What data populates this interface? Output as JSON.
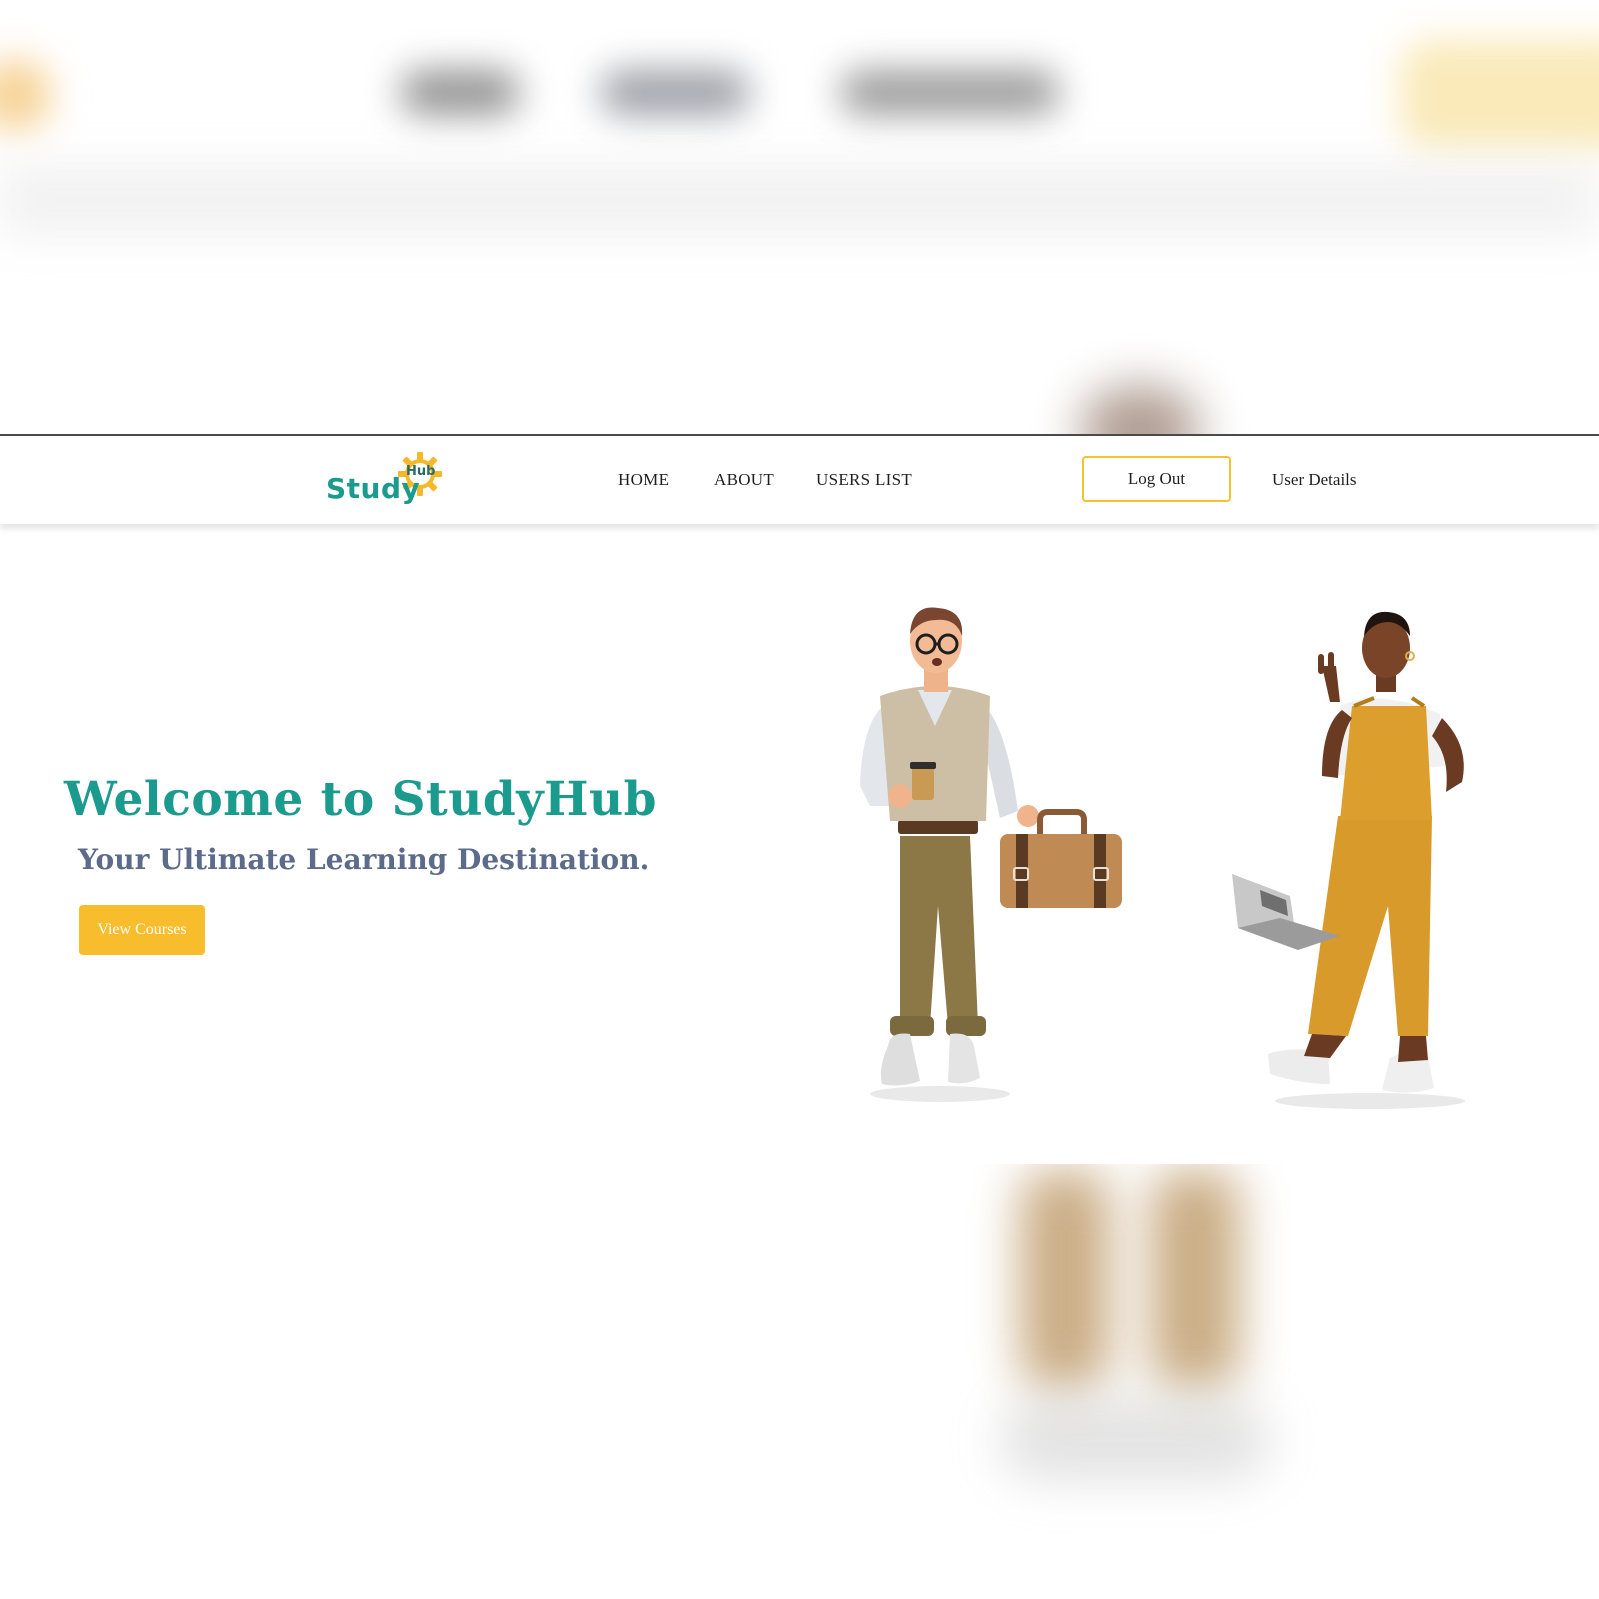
{
  "brand": {
    "logo_word": "Study",
    "logo_sub": "Hub",
    "logo_alt": "StudyHub logo",
    "primary_color": "#1b9a8e",
    "accent_color": "#f7bd2c"
  },
  "nav": {
    "items": [
      {
        "label": "HOME"
      },
      {
        "label": "ABOUT"
      },
      {
        "label": "USERS LIST"
      }
    ],
    "logout_label": "Log Out",
    "user_details_label": "User Details"
  },
  "hero": {
    "title": "Welcome to StudyHub",
    "subtitle": "Your Ultimate Learning Destination.",
    "cta_label": "View Courses",
    "illustration": "two-students-illustration"
  }
}
